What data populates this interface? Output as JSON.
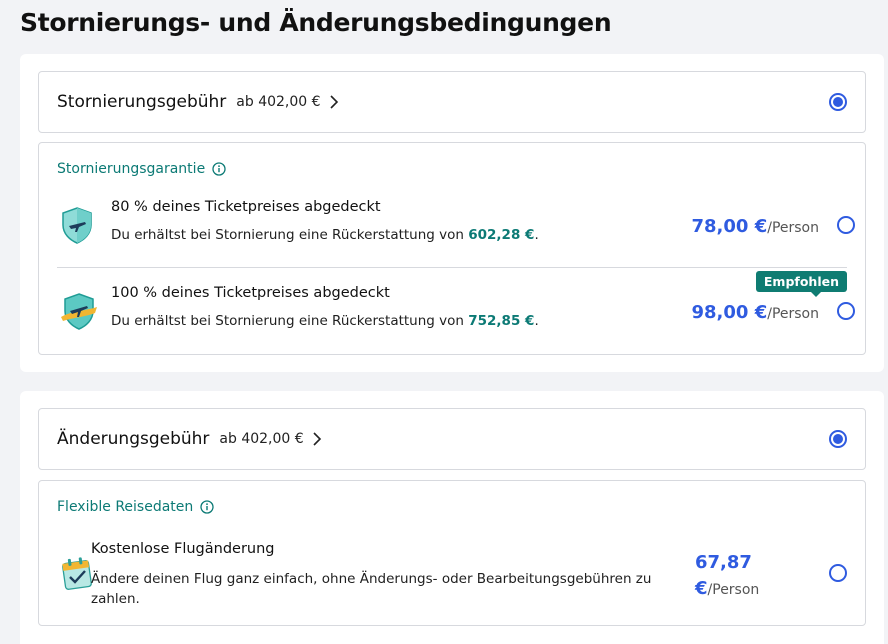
{
  "page": {
    "title": "Stornierungs- und Änderungsbedingungen"
  },
  "colors": {
    "accent": "#2f5be0",
    "teal": "#0c7a75",
    "badge": "#0f7c72"
  },
  "cancellation": {
    "fee_title": "Stornierungsgebühr",
    "fee_from": "ab 402,00 €",
    "fee_selected": true,
    "panel_heading": "Stornierungsgarantie",
    "options": [
      {
        "icon": "shield-plane-icon",
        "title": "80 % deines Ticketpreises abgedeckt",
        "desc_prefix": "Du erhältst bei Stornierung eine Rückerstattung von ",
        "refund": "602,28 €",
        "desc_suffix": ".",
        "price": "78,00 €",
        "per": "/Person",
        "selected": false
      },
      {
        "icon": "shield-plane-gold-icon",
        "title": "100 % deines Ticketpreises abgedeckt",
        "desc_prefix": "Du erhältst bei Stornierung eine Rückerstattung von ",
        "refund": "752,85 €",
        "desc_suffix": ".",
        "price": "98,00 €",
        "per": "/Person",
        "selected": false,
        "badge": "Empfohlen"
      }
    ]
  },
  "change": {
    "fee_title": "Änderungsgebühr",
    "fee_from": "ab 402,00 €",
    "fee_selected": true,
    "panel_heading": "Flexible Reisedaten",
    "option": {
      "icon": "calendar-check-icon",
      "title": "Kostenlose Flugänderung",
      "desc": "Ändere deinen Flug ganz einfach, ohne Änderungs- oder Bearbeitungsgebühren zu zahlen.",
      "price_line1": "67,87",
      "price_line2": "€",
      "per": "/Person",
      "selected": false
    }
  }
}
